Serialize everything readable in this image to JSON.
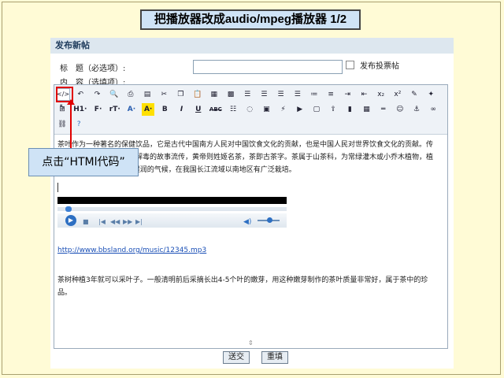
{
  "slide_title": "把播放器改成audio/mpeg播放器 1/2",
  "panel": {
    "header": "发布新帖",
    "title_label": "标　题（必选项）:",
    "content_label": "内　容（选填项）:",
    "title_value": "",
    "poll_label": "发布投票帖",
    "poll_checked": false
  },
  "toolbar": {
    "row1": [
      "html-code",
      "undo",
      "redo",
      "preview",
      "print",
      "template",
      "cut",
      "copy",
      "paste",
      "paste-text",
      "paste-word",
      "align-left",
      "align-center",
      "align-right",
      "justify",
      "ordered-list",
      "unordered-list",
      "indent",
      "outdent",
      "subscript",
      "superscript",
      "clear-format",
      "select-all",
      "cursor"
    ],
    "row2_labels": [
      "H1·",
      "F·",
      "rT·",
      "A·",
      "A·",
      "B",
      "I",
      "U",
      "ABC"
    ],
    "row2_icons": [
      "strike",
      "image",
      "flash",
      "media",
      "table",
      "hr",
      "emoticon",
      "special-char",
      "anchor",
      "link"
    ],
    "row3_icons": [
      "unlink",
      "about"
    ]
  },
  "content": {
    "paragraph1": "茶叶作为一种著名的保健饮品，它是古代中国南方人民对中国饮食文化的贡献，也是中国人民对世界饮食文化的贡献。传说中国古代的神农有以茶解毒的故事流传，黄帝则姓姬名茶，茶即古茶字。茶属于山茶科，为常绿灌木或小乔木植物，植株高达1-6米。茶树喜欢湿润的气候，在我国长江流域以南地区有广泛栽培。",
    "link": "http://www.bbsland.org/music/12345.mp3",
    "paragraph2": "茶树种植3年就可以采叶子。一般清明前后采摘长出4-5个叶的嫩芽，用这种嫩芽制作的茶叶质量非常好，属于茶中的珍品。"
  },
  "player": {
    "controls": [
      "play",
      "stop",
      "prev",
      "rewind",
      "forward",
      "next",
      "volume"
    ]
  },
  "buttons": {
    "submit": "送交",
    "reset": "重填"
  },
  "callout": "点击“HTMl代码”",
  "colors": {
    "highlight": "#e00000",
    "callout_bg": "#cfe3f6",
    "slide_bg": "#fffbd6",
    "link": "#1a4fb6"
  }
}
